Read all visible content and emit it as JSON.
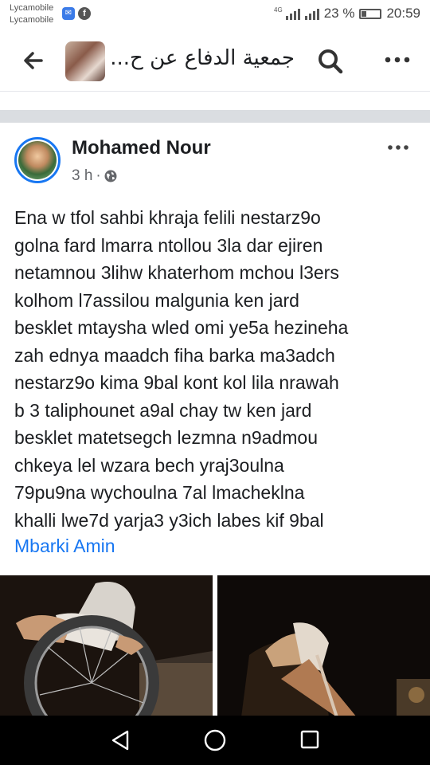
{
  "status_bar": {
    "carrier_1": "Lycamobile",
    "carrier_2": "Lycamobile",
    "network": "4G",
    "battery": "23 %",
    "time": "20:59"
  },
  "header": {
    "title": "جمعية الدفاع عن ح...",
    "icons": [
      "back-arrow-icon",
      "group-avatar",
      "search-icon",
      "more-icon"
    ]
  },
  "post": {
    "author": "Mohamed Nour",
    "time": "3 h",
    "separator": "·",
    "privacy_icon": "globe-icon",
    "body_lines": [
      "Ena w tfol sahbi khraja felili nestarz9o",
      "golna fard lmarra ntollou 3la dar ejiren",
      "netamnou 3lihw khaterhom mchou l3ers",
      "kolhom l7assilou malgunia ken jard",
      "besklet mtaysha wled omi ye5a hezineha",
      "zah ednya maadch fiha barka ma3adch",
      "nestarz9o kima 9bal kont kol lila nrawah",
      "b 3 taliphounet a9al chay tw ken jard",
      "besklet matetsegch lezmna n9admou",
      "chkeya lel wzara bech yraj3oulna",
      "79pu9na wychoulna 7al lmacheklna",
      "khalli lwe7d yarja3 y3ich labes kif 9bal"
    ],
    "mention": "Mbarki Amin"
  },
  "photos": [
    "photo-bicycle-wheel",
    "photo-bicycle-close-up"
  ],
  "nav_bar": [
    "nav-back-icon",
    "nav-home-icon",
    "nav-recents-icon"
  ],
  "colors": {
    "accent": "#1877f2",
    "separator": "#dadde1",
    "text": "#1c1e21",
    "meta": "#65676b"
  }
}
